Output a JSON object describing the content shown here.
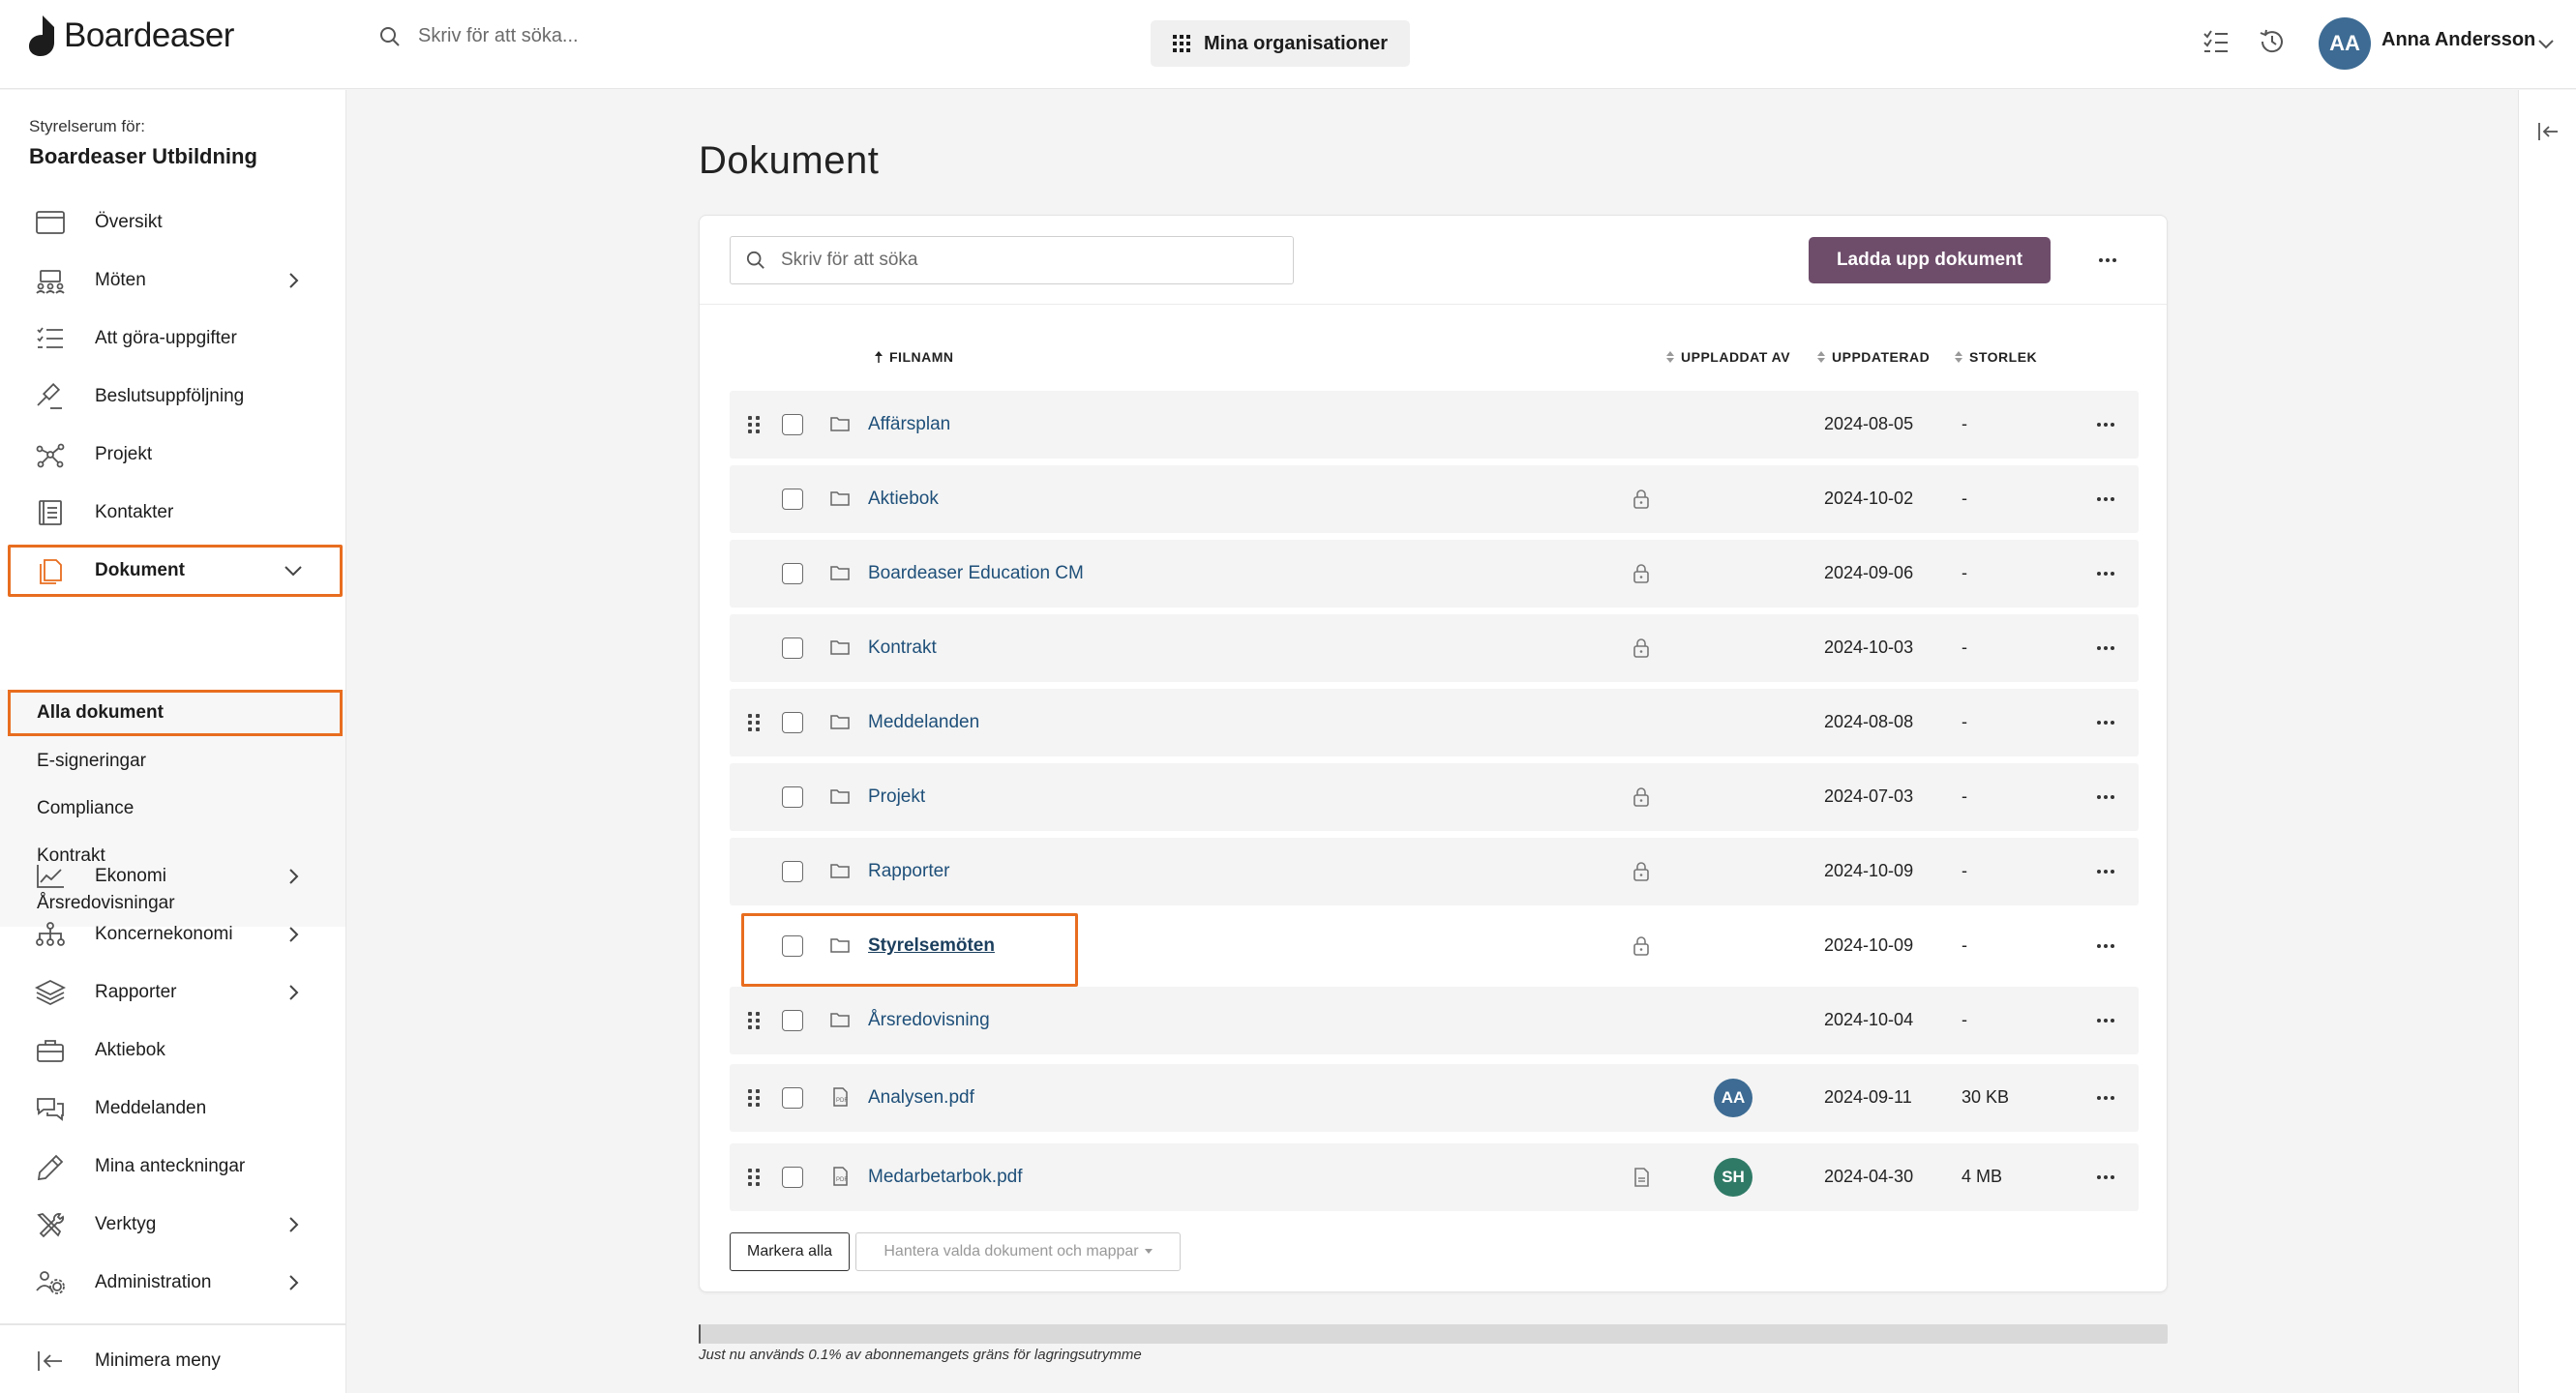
{
  "app": {
    "name": "Boardeaser"
  },
  "topbar": {
    "search_placeholder": "Skriv för att söka...",
    "org_button": "Mina organisationer",
    "user_initials": "AA",
    "user_name": "Anna Andersson"
  },
  "sidebar": {
    "subtitle": "Styrelserum för:",
    "title": "Boardeaser Utbildning",
    "items": [
      {
        "label": "Översikt",
        "icon": "overview-icon"
      },
      {
        "label": "Möten",
        "icon": "meetings-icon"
      },
      {
        "label": "Att göra-uppgifter",
        "icon": "tasks-icon"
      },
      {
        "label": "Beslutsuppföljning",
        "icon": "gavel-icon"
      },
      {
        "label": "Projekt",
        "icon": "project-icon"
      },
      {
        "label": "Kontakter",
        "icon": "contacts-icon"
      },
      {
        "label": "Dokument",
        "icon": "documents-icon"
      }
    ],
    "doc_subitems": [
      {
        "label": "Alla dokument",
        "active": true
      },
      {
        "label": "E-signeringar"
      },
      {
        "label": "Compliance"
      },
      {
        "label": "Kontrakt"
      },
      {
        "label": "Årsredovisningar"
      }
    ],
    "items2": [
      {
        "label": "Ekonomi",
        "icon": "chart-icon"
      },
      {
        "label": "Koncernekonomi",
        "icon": "org-icon"
      },
      {
        "label": "Rapporter",
        "icon": "layers-icon"
      },
      {
        "label": "Aktiebok",
        "icon": "briefcase-icon"
      },
      {
        "label": "Meddelanden",
        "icon": "chat-icon"
      },
      {
        "label": "Mina anteckningar",
        "icon": "pencil-icon"
      },
      {
        "label": "Verktyg",
        "icon": "tools-icon"
      },
      {
        "label": "Administration",
        "icon": "admin-icon"
      }
    ],
    "minimize": "Minimera meny"
  },
  "main": {
    "title": "Dokument",
    "search_placeholder": "Skriv för att söka",
    "upload_button": "Ladda upp dokument",
    "columns": {
      "filename": "FILNAMN",
      "uploaded_by": "UPPLADDAT AV",
      "updated": "UPPDATERAD",
      "size": "STORLEK"
    },
    "rows": [
      {
        "name": "Affärsplan",
        "type": "folder",
        "drag": true,
        "lock": false,
        "uploader": "",
        "date": "2024-08-05",
        "size": "-"
      },
      {
        "name": "Aktiebok",
        "type": "folder",
        "drag": false,
        "lock": true,
        "uploader": "",
        "date": "2024-10-02",
        "size": "-"
      },
      {
        "name": "Boardeaser Education CM",
        "type": "folder",
        "drag": false,
        "lock": true,
        "uploader": "",
        "date": "2024-09-06",
        "size": "-"
      },
      {
        "name": "Kontrakt",
        "type": "folder",
        "drag": false,
        "lock": true,
        "uploader": "",
        "date": "2024-10-03",
        "size": "-"
      },
      {
        "name": "Meddelanden",
        "type": "folder",
        "drag": true,
        "lock": false,
        "uploader": "",
        "date": "2024-08-08",
        "size": "-"
      },
      {
        "name": "Projekt",
        "type": "folder",
        "drag": false,
        "lock": true,
        "uploader": "",
        "date": "2024-07-03",
        "size": "-"
      },
      {
        "name": "Rapporter",
        "type": "folder",
        "drag": false,
        "lock": true,
        "uploader": "",
        "date": "2024-10-09",
        "size": "-"
      },
      {
        "name": "Styrelsemöten",
        "type": "folder",
        "drag": false,
        "lock": true,
        "uploader": "",
        "date": "2024-10-09",
        "size": "-",
        "highlight": true
      },
      {
        "name": "Årsredovisning",
        "type": "folder",
        "drag": true,
        "lock": false,
        "uploader": "",
        "date": "2024-10-04",
        "size": "-"
      },
      {
        "name": "Analysen.pdf",
        "type": "file",
        "drag": true,
        "lock": false,
        "uploader": "AA",
        "uploader_color": "#3d6b93",
        "date": "2024-09-11",
        "size": "30 KB"
      },
      {
        "name": "Medarbetarbok.pdf",
        "type": "file",
        "drag": true,
        "lock": false,
        "file_badge": true,
        "uploader": "SH",
        "uploader_color": "#2f7a66",
        "date": "2024-04-30",
        "size": "4 MB"
      }
    ],
    "select_all": "Markera alla",
    "manage_selected": "Hantera valda dokument och mappar",
    "storage_used_fraction": 0.001,
    "storage_text": "Just nu används 0.1% av abonnemangets gräns för lagringsutrymme"
  },
  "colors": {
    "accent": "#6e4d6b",
    "highlight_outline": "#e86d1f",
    "link": "#1e4f79"
  }
}
